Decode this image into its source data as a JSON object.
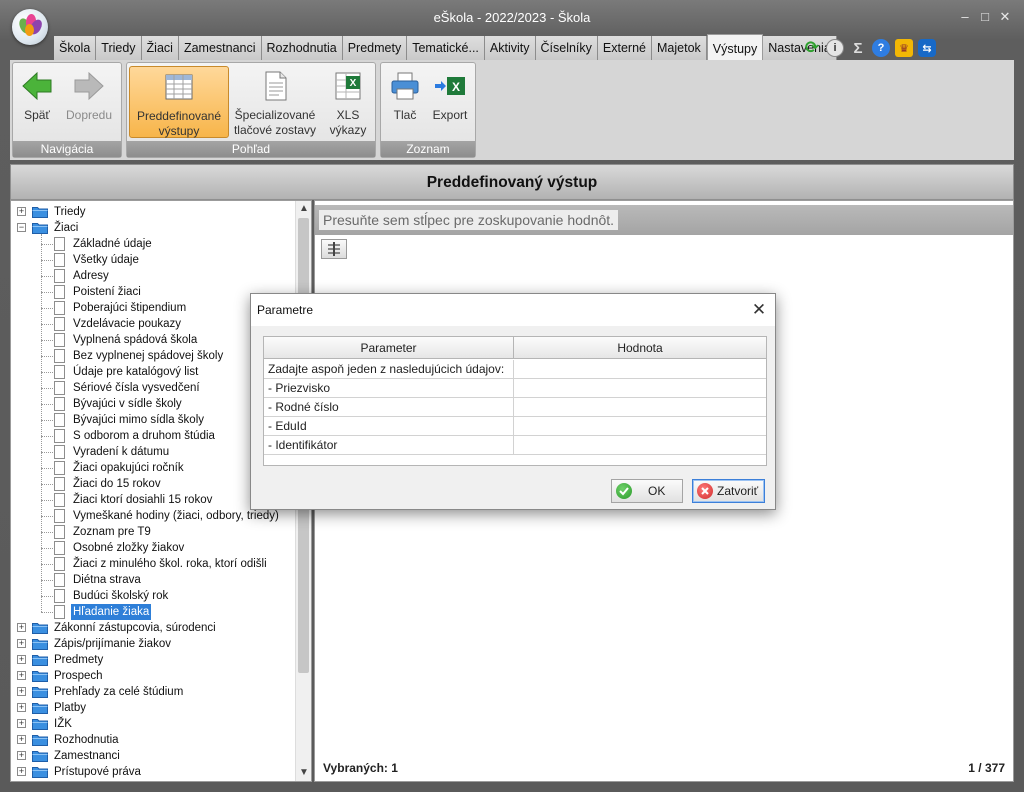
{
  "window": {
    "title": "eŠkola - 2022/2023 - Škola",
    "controls": [
      "–",
      "□",
      "✕"
    ]
  },
  "tabs": [
    "Škola",
    "Triedy",
    "Žiaci",
    "Zamestnanci",
    "Rozhodnutia",
    "Predmety",
    "Tematické...",
    "Aktivity",
    "Číselníky",
    "Externé",
    "Majetok",
    "Výstupy",
    "Nastavenia"
  ],
  "active_tab": "Výstupy",
  "toolbar_icons": [
    "refresh-icon",
    "info-icon",
    "sigma-icon",
    "help-icon",
    "crown-icon",
    "teamviewer-icon"
  ],
  "ribbon": {
    "groups": [
      {
        "label": "Navigácia",
        "buttons": [
          {
            "label": "Späť",
            "icon": "arrow-left-icon",
            "disabled": false
          },
          {
            "label": "Dopredu",
            "icon": "arrow-right-icon",
            "disabled": true
          }
        ]
      },
      {
        "label": "Pohľad",
        "buttons": [
          {
            "label": "Preddefinované výstupy",
            "line1": "Preddefinované",
            "line2": "výstupy",
            "icon": "table-icon",
            "active": true
          },
          {
            "label": "Špecializované tlačové zostavy",
            "line1": "Špecializované",
            "line2": "tlačové zostavy",
            "icon": "document-icon"
          },
          {
            "label": "XLS výkazy",
            "line1": "XLS",
            "line2": "výkazy",
            "icon": "excel-sheet-icon"
          }
        ]
      },
      {
        "label": "Zoznam",
        "buttons": [
          {
            "label": "Tlač",
            "icon": "printer-icon"
          },
          {
            "label": "Export",
            "icon": "excel-export-icon"
          }
        ]
      }
    ]
  },
  "panel_title": "Preddefinovaný výstup",
  "tree": {
    "root_before": [
      "Triedy"
    ],
    "expanded": "Žiaci",
    "children": [
      "Základné údaje",
      "Všetky údaje",
      "Adresy",
      "Poistení žiaci",
      "Poberajúci štipendium",
      "Vzdelávacie poukazy",
      "Vyplnená spádová škola",
      "Bez vyplnenej spádovej školy",
      "Údaje pre katalógový list",
      "Sériové čísla vysvedčení",
      "Bývajúci v sídle školy",
      "Bývajúci mimo sídla školy",
      "S odborom a druhom štúdia",
      "Vyradení k dátumu",
      "Žiaci opakujúci ročník",
      "Žiaci do 15 rokov",
      "Žiaci ktorí dosiahli 15 rokov",
      "Vymeškané hodiny (žiaci, odbory, triedy)",
      "Zoznam pre T9",
      "Osobné zložky žiakov",
      "Žiaci z minulého škol. roka, ktorí odišli",
      "Diétna strava",
      "Budúci školský rok",
      "Hľadanie žiaka"
    ],
    "selected": "Hľadanie žiaka",
    "root_after": [
      "Zákonní zástupcovia, súrodenci",
      "Zápis/prijímanie žiakov",
      "Predmety",
      "Prospech",
      "Prehľady za celé štúdium",
      "Platby",
      "IŽK",
      "Rozhodnutia",
      "Zamestnanci",
      "Prístupové práva"
    ]
  },
  "grid": {
    "group_hint": "Presuňte sem stĺpec pre zoskupovanie hodnôt.",
    "status_selected": "Vybraných: 1",
    "status_count": "1 / 377"
  },
  "dialog": {
    "title": "Parametre",
    "columns": [
      "Parameter",
      "Hodnota"
    ],
    "rows": [
      {
        "parameter": "Zadajte aspoň jeden z nasledujúcich údajov:",
        "value": ""
      },
      {
        "parameter": "- Priezvisko",
        "value": ""
      },
      {
        "parameter": "- Rodné číslo",
        "value": ""
      },
      {
        "parameter": "- EduId",
        "value": ""
      },
      {
        "parameter": "- Identifikátor",
        "value": ""
      }
    ],
    "ok_label": "OK",
    "close_label": "Zatvoriť"
  }
}
